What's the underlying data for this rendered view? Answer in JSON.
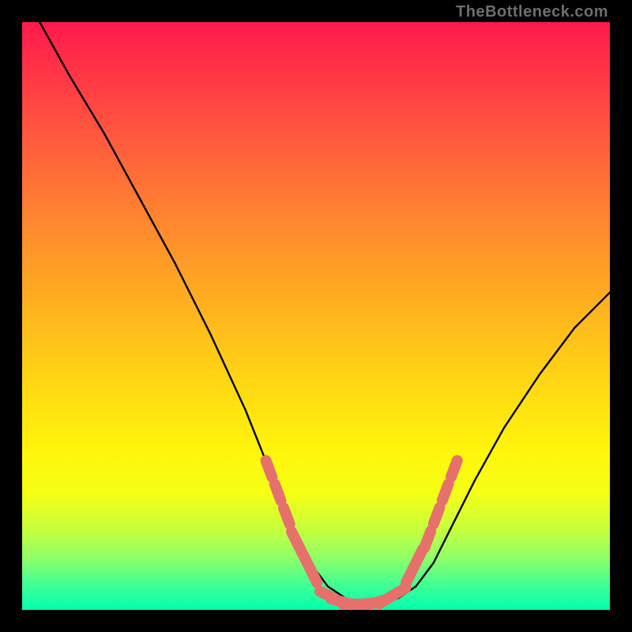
{
  "watermark": "TheBottleneck.com",
  "palette": {
    "background": "#000000",
    "curve": "#000000",
    "markers": "#e6716c",
    "gradient_stops": [
      "#ff1a4c",
      "#ff3346",
      "#ff5a3d",
      "#ff8a2e",
      "#ffb01f",
      "#ffd913",
      "#fff50b",
      "#f5ff14",
      "#c9ff3a",
      "#91ff66",
      "#4dff8e",
      "#1fffa4",
      "#00ffac"
    ]
  },
  "chart_data": {
    "type": "line",
    "title": "",
    "xlabel": "",
    "ylabel": "",
    "xlim": [
      0,
      100
    ],
    "ylim": [
      0,
      100
    ],
    "series": [
      {
        "name": "curve",
        "x": [
          3,
          8,
          14,
          20,
          26,
          32,
          38,
          42,
          46,
          49,
          52,
          55,
          58,
          61,
          64,
          67,
          70,
          73,
          77,
          82,
          88,
          94,
          100
        ],
        "y": [
          100,
          91,
          81,
          70,
          59,
          47,
          34,
          24,
          14,
          8,
          4,
          2,
          1,
          1,
          2,
          4,
          8,
          14,
          22,
          31,
          40,
          48,
          54
        ]
      }
    ],
    "markers": [
      {
        "name": "left-cluster",
        "x": [
          42,
          43.5,
          45,
          46.5,
          48,
          49.5
        ],
        "y": [
          24,
          20,
          16,
          12,
          9,
          6
        ]
      },
      {
        "name": "bottom-cluster",
        "x": [
          52,
          54,
          56,
          58,
          60,
          62,
          64
        ],
        "y": [
          2.5,
          1.5,
          1,
          1,
          1.2,
          1.8,
          3
        ]
      },
      {
        "name": "right-cluster",
        "x": [
          66,
          67.5,
          69,
          70.5,
          72,
          73.5
        ],
        "y": [
          6,
          9,
          12,
          16,
          20,
          24
        ]
      }
    ]
  }
}
